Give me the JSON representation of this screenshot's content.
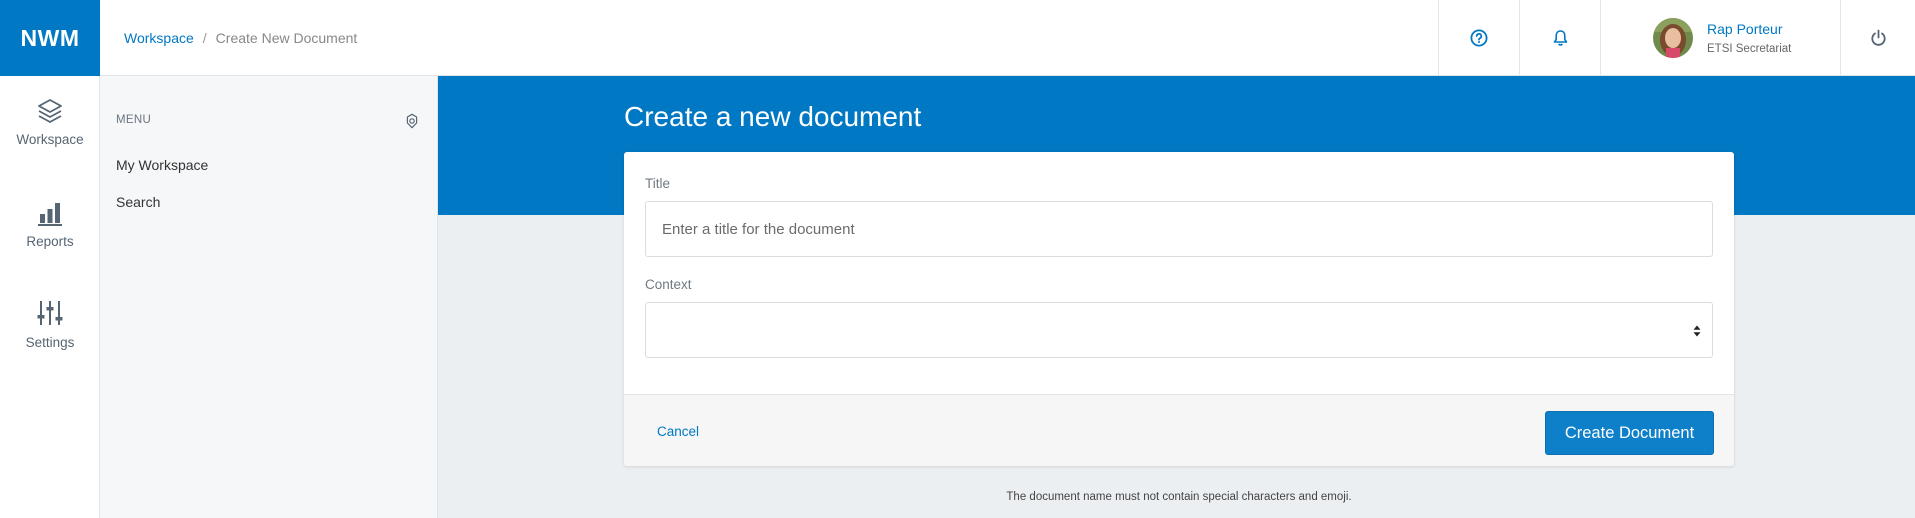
{
  "app": {
    "logo_text": "NWM",
    "brand_color": "#0078c3"
  },
  "breadcrumb": {
    "root": "Workspace",
    "separator": "/",
    "current": "Create New Document"
  },
  "header": {
    "help_icon": "question-circle-icon",
    "notifications_icon": "bell-icon",
    "user": {
      "name": "Rap Porteur",
      "org": "ETSI Secretariat"
    },
    "power_icon": "power-icon"
  },
  "rail": {
    "items": [
      {
        "label": "Workspace",
        "icon": "layers-icon"
      },
      {
        "label": "Reports",
        "icon": "bar-chart-icon"
      },
      {
        "label": "Settings",
        "icon": "sliders-icon"
      }
    ]
  },
  "menu": {
    "heading": "MENU",
    "settings_icon": "gear-icon",
    "items": [
      {
        "label": "My Workspace"
      },
      {
        "label": "Search"
      }
    ]
  },
  "page": {
    "title": "Create a new document"
  },
  "form": {
    "title_label": "Title",
    "title_placeholder": "Enter a title for the document",
    "title_value": "",
    "context_label": "Context",
    "context_value": "",
    "cancel_label": "Cancel",
    "submit_label": "Create Document"
  },
  "footnote": "The document name must not contain special characters and emoji."
}
